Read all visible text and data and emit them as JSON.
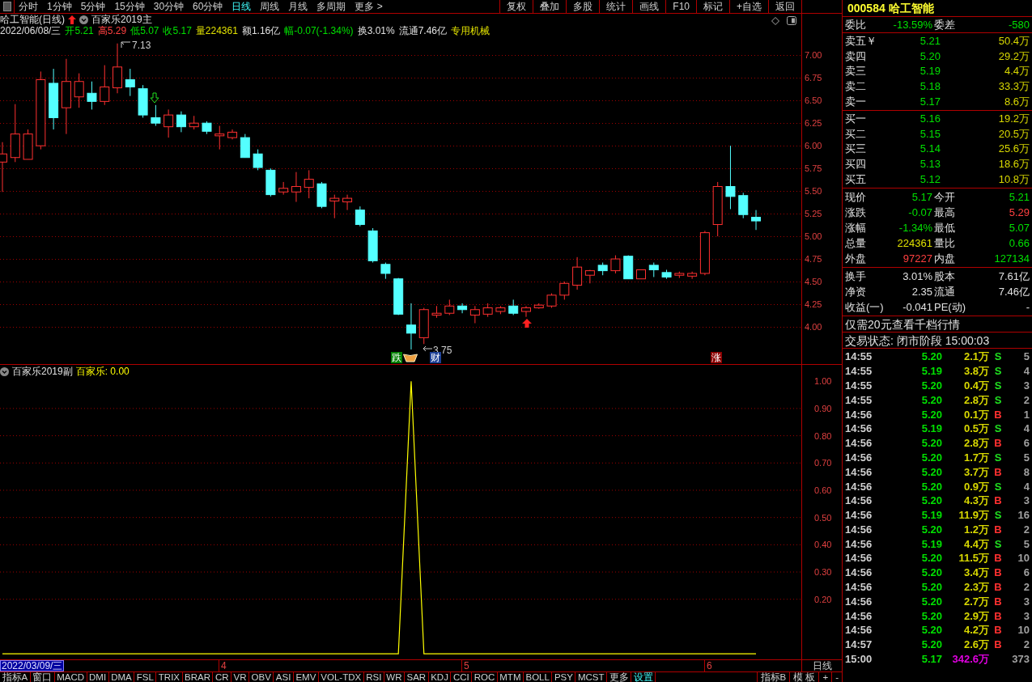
{
  "period_tabs": [
    {
      "label": "分时",
      "selected": false
    },
    {
      "label": "1分钟",
      "selected": false
    },
    {
      "label": "5分钟",
      "selected": false
    },
    {
      "label": "15分钟",
      "selected": false
    },
    {
      "label": "30分钟",
      "selected": false
    },
    {
      "label": "60分钟",
      "selected": false
    },
    {
      "label": "日线",
      "selected": true
    },
    {
      "label": "周线",
      "selected": false
    },
    {
      "label": "月线",
      "selected": false
    },
    {
      "label": "多周期",
      "selected": false
    },
    {
      "label": "更多 >",
      "selected": false
    }
  ],
  "toolbar_buttons": [
    "复权",
    "叠加",
    "多股",
    "统计",
    "画线",
    "F10",
    "标记",
    "+自选",
    "返回"
  ],
  "main_chart": {
    "title": "哈工智能(日线)",
    "indicator": "百家乐2019主",
    "info": [
      {
        "text": "2022/06/08/三",
        "color": "#e0e0e0"
      },
      {
        "text": "开5.21",
        "color": "#00e000"
      },
      {
        "text": "高5.29",
        "color": "#ff4040"
      },
      {
        "text": "低5.07",
        "color": "#00e000"
      },
      {
        "text": "收5.17",
        "color": "#00e000"
      },
      {
        "text": "量224361",
        "color": "#e0e000"
      },
      {
        "text": "额1.16亿",
        "color": "#e0e0e0"
      },
      {
        "text": "幅-0.07(-1.34%)",
        "color": "#00e000"
      },
      {
        "text": "换3.01%",
        "color": "#e0e0e0"
      },
      {
        "text": "流通7.46亿",
        "color": "#e0e0e0"
      },
      {
        "text": "专用机械",
        "color": "#e0e000"
      }
    ],
    "chart_data": {
      "type": "candlestick",
      "grid": true,
      "ylim": [
        3.58,
        7.61
      ],
      "yticks": [
        {
          "value": 7,
          "label": "7.00"
        },
        {
          "value": 6.75,
          "label": "6.75"
        },
        {
          "value": 6.5,
          "label": "6.50"
        },
        {
          "value": 6.25,
          "label": "6.25"
        },
        {
          "value": 6,
          "label": "6.00"
        },
        {
          "value": 5.75,
          "label": "5.75"
        },
        {
          "value": 5.5,
          "label": "5.50"
        },
        {
          "value": 5.25,
          "label": "5.25"
        },
        {
          "value": 5,
          "label": "5.00"
        },
        {
          "value": 4.75,
          "label": "4.75"
        },
        {
          "value": 4.5,
          "label": "4.50"
        },
        {
          "value": 4.25,
          "label": "4.25"
        },
        {
          "value": 4,
          "label": "4.00"
        }
      ],
      "ohlc": [
        [
          5.82,
          6.04,
          5.49,
          5.91
        ],
        [
          5.87,
          6.46,
          5.82,
          6.13
        ],
        [
          5.85,
          6.18,
          5.85,
          6.13
        ],
        [
          6.0,
          6.82,
          5.96,
          6.73
        ],
        [
          6.69,
          6.85,
          6.18,
          6.31
        ],
        [
          6.42,
          6.96,
          6.13,
          6.71
        ],
        [
          6.54,
          6.8,
          6.42,
          6.71
        ],
        [
          6.58,
          6.71,
          6.4,
          6.49
        ],
        [
          6.49,
          6.89,
          6.45,
          6.65
        ],
        [
          6.64,
          7.13,
          6.58,
          6.87
        ],
        [
          6.73,
          6.85,
          6.55,
          6.65
        ],
        [
          6.63,
          6.67,
          6.31,
          6.34
        ],
        [
          6.31,
          6.45,
          6.22,
          6.25
        ],
        [
          6.21,
          6.4,
          6.09,
          6.34
        ],
        [
          6.34,
          6.38,
          6.15,
          6.21
        ],
        [
          6.21,
          6.33,
          6.18,
          6.25
        ],
        [
          6.25,
          6.27,
          6.13,
          6.16
        ],
        [
          6.11,
          6.22,
          5.96,
          6.13
        ],
        [
          6.09,
          6.18,
          6.07,
          6.15
        ],
        [
          6.09,
          6.13,
          5.87,
          5.87
        ],
        [
          5.91,
          5.96,
          5.73,
          5.76
        ],
        [
          5.73,
          5.75,
          5.44,
          5.46
        ],
        [
          5.49,
          5.6,
          5.46,
          5.53
        ],
        [
          5.49,
          5.71,
          5.38,
          5.55
        ],
        [
          5.54,
          5.73,
          5.42,
          5.63
        ],
        [
          5.58,
          5.6,
          5.31,
          5.33
        ],
        [
          5.39,
          5.46,
          5.2,
          5.42
        ],
        [
          5.38,
          5.46,
          5.29,
          5.42
        ],
        [
          5.29,
          5.33,
          5.11,
          5.13
        ],
        [
          5.06,
          5.09,
          4.71,
          4.73
        ],
        [
          4.69,
          4.71,
          4.53,
          4.59
        ],
        [
          4.53,
          4.54,
          4.13,
          4.14
        ],
        [
          4.02,
          4.26,
          3.75,
          3.93
        ],
        [
          3.88,
          4.21,
          3.81,
          4.19
        ],
        [
          4.13,
          4.23,
          4.1,
          4.15
        ],
        [
          4.15,
          4.3,
          4.13,
          4.23
        ],
        [
          4.23,
          4.26,
          4.15,
          4.19
        ],
        [
          4.13,
          4.23,
          4.04,
          4.19
        ],
        [
          4.14,
          4.26,
          4.11,
          4.21
        ],
        [
          4.17,
          4.23,
          4.14,
          4.21
        ],
        [
          4.23,
          4.3,
          4.13,
          4.15
        ],
        [
          4.17,
          4.23,
          4.11,
          4.21
        ],
        [
          4.21,
          4.26,
          4.2,
          4.24
        ],
        [
          4.23,
          4.37,
          4.21,
          4.35
        ],
        [
          4.35,
          4.5,
          4.3,
          4.48
        ],
        [
          4.46,
          4.77,
          4.41,
          4.66
        ],
        [
          4.57,
          4.63,
          4.48,
          4.62
        ],
        [
          4.68,
          4.71,
          4.57,
          4.62
        ],
        [
          4.62,
          4.79,
          4.59,
          4.75
        ],
        [
          4.78,
          4.79,
          4.53,
          4.53
        ],
        [
          4.53,
          4.63,
          4.53,
          4.63
        ],
        [
          4.68,
          4.71,
          4.55,
          4.63
        ],
        [
          4.6,
          4.63,
          4.53,
          4.55
        ],
        [
          4.57,
          4.61,
          4.54,
          4.59
        ],
        [
          4.56,
          4.61,
          4.53,
          4.59
        ],
        [
          4.59,
          5.06,
          4.57,
          5.04
        ],
        [
          5.13,
          5.6,
          5.0,
          5.55
        ],
        [
          5.55,
          6.0,
          5.3,
          5.44
        ],
        [
          5.45,
          5.48,
          5.2,
          5.24
        ],
        [
          5.21,
          5.29,
          5.07,
          5.17
        ]
      ]
    },
    "high_label": "7.13",
    "low_label": "3.75",
    "badges": [
      {
        "text": "跌",
        "color": "#008000"
      },
      {
        "text": "财",
        "color": "#1c3f94"
      },
      {
        "text": "涨",
        "color": "#8b0000"
      }
    ]
  },
  "sub_chart": {
    "title": "百家乐2019副",
    "legend_value": ": 0.00",
    "chart_data": {
      "type": "line",
      "grid": true,
      "ylim": [
        -0.065,
        1.06
      ],
      "yticks": [
        {
          "value": 1,
          "label": "1.00"
        },
        {
          "value": 0.9,
          "label": "0.90"
        },
        {
          "value": 0.8,
          "label": "0.80"
        },
        {
          "value": 0.7,
          "label": "0.70"
        },
        {
          "value": 0.6,
          "label": "0.60"
        },
        {
          "value": 0.5,
          "label": "0.50"
        },
        {
          "value": 0.4,
          "label": "0.40"
        },
        {
          "value": 0.3,
          "label": "0.30"
        },
        {
          "value": 0.2,
          "label": "0.20"
        }
      ],
      "series": [
        {
          "name": "百家乐",
          "color": "#ffff00",
          "values": [
            0,
            0,
            0,
            0,
            0,
            0,
            0,
            0,
            0,
            0,
            0,
            0,
            0,
            0,
            0,
            0,
            0,
            0,
            0,
            0,
            0,
            0,
            0,
            0,
            0,
            0,
            0,
            0,
            0,
            0,
            0,
            0,
            1,
            0,
            0,
            0,
            0,
            0,
            0,
            0,
            0,
            0,
            0,
            0,
            0,
            0,
            0,
            0,
            0,
            0,
            0,
            0,
            0,
            0,
            0,
            0,
            0,
            0,
            0,
            0,
            null,
            null,
            null
          ]
        }
      ]
    }
  },
  "date_axis": {
    "current": "2022/03/09/三",
    "months": [
      "4",
      "5",
      "6"
    ],
    "period": "日线"
  },
  "indicator_tabs": [
    {
      "label": "指标A",
      "highlighted": false
    },
    {
      "label": "窗口",
      "highlighted": false
    },
    {
      "label": "MACD",
      "highlighted": false
    },
    {
      "label": "DMI",
      "highlighted": false
    },
    {
      "label": "DMA",
      "highlighted": false
    },
    {
      "label": "FSL",
      "highlighted": false
    },
    {
      "label": "TRIX",
      "highlighted": false
    },
    {
      "label": "BRAR",
      "highlighted": false
    },
    {
      "label": "CR",
      "highlighted": false
    },
    {
      "label": "VR",
      "highlighted": false
    },
    {
      "label": "OBV",
      "highlighted": false
    },
    {
      "label": "ASI",
      "highlighted": false
    },
    {
      "label": "EMV",
      "highlighted": false
    },
    {
      "label": "VOL-TDX",
      "highlighted": false
    },
    {
      "label": "RSI",
      "highlighted": false
    },
    {
      "label": "WR",
      "highlighted": false
    },
    {
      "label": "SAR",
      "highlighted": false
    },
    {
      "label": "KDJ",
      "highlighted": false
    },
    {
      "label": "CCI",
      "highlighted": false
    },
    {
      "label": "ROC",
      "highlighted": false
    },
    {
      "label": "MTM",
      "highlighted": false
    },
    {
      "label": "BOLL",
      "highlighted": false
    },
    {
      "label": "PSY",
      "highlighted": false
    },
    {
      "label": "MCST",
      "highlighted": false
    },
    {
      "label": "更多",
      "highlighted": false
    },
    {
      "label": "设置",
      "highlighted": true
    }
  ],
  "indicator_tabs_right": [
    "指标B",
    "模 板",
    "+",
    "-"
  ],
  "quote": {
    "title": "000584 哈工智能",
    "ratio": [
      {
        "text": "委比"
      },
      {
        "text": "-13.59%",
        "color": "#00e000"
      },
      {
        "text": "委差"
      },
      {
        "text": "-580",
        "color": "#00e000"
      }
    ],
    "sell": [
      {
        "label": "卖五￥",
        "price": "5.21",
        "volume": "50.4万"
      },
      {
        "label": "卖四",
        "price": "5.20",
        "volume": "29.2万"
      },
      {
        "label": "卖三",
        "price": "5.19",
        "volume": "4.4万"
      },
      {
        "label": "卖二",
        "price": "5.18",
        "volume": "33.3万"
      },
      {
        "label": "卖一",
        "price": "5.17",
        "volume": "8.6万"
      }
    ],
    "buy": [
      {
        "label": "买一",
        "price": "5.16",
        "volume": "19.2万"
      },
      {
        "label": "买二",
        "price": "5.15",
        "volume": "20.5万"
      },
      {
        "label": "买三",
        "price": "5.14",
        "volume": "25.6万"
      },
      {
        "label": "买四",
        "price": "5.13",
        "volume": "18.6万"
      },
      {
        "label": "买五",
        "price": "5.12",
        "volume": "10.8万"
      }
    ],
    "stats": [
      [
        {
          "text": "现价"
        },
        {
          "text": "5.17",
          "color": "#00e000"
        },
        {
          "text": "今开"
        },
        {
          "text": "5.21",
          "color": "#00e000"
        }
      ],
      [
        {
          "text": "涨跌"
        },
        {
          "text": "-0.07",
          "color": "#00e000"
        },
        {
          "text": "最高"
        },
        {
          "text": "5.29",
          "color": "#ff4040"
        }
      ],
      [
        {
          "text": "涨幅"
        },
        {
          "text": "-1.34%",
          "color": "#00e000"
        },
        {
          "text": "最低"
        },
        {
          "text": "5.07",
          "color": "#00e000"
        }
      ],
      [
        {
          "text": "总量"
        },
        {
          "text": "224361",
          "color": "#e0e000"
        },
        {
          "text": "量比"
        },
        {
          "text": "0.66",
          "color": "#00e000"
        }
      ],
      [
        {
          "text": "外盘"
        },
        {
          "text": "97227",
          "color": "#ff4040"
        },
        {
          "text": "内盘"
        },
        {
          "text": "127134",
          "color": "#00e000"
        }
      ]
    ],
    "finance": [
      [
        {
          "text": "换手"
        },
        {
          "text": "3.01%"
        },
        {
          "text": "股本"
        },
        {
          "text": "7.61亿"
        }
      ],
      [
        {
          "text": "净资"
        },
        {
          "text": "2.35"
        },
        {
          "text": "流通"
        },
        {
          "text": "7.46亿"
        }
      ],
      [
        {
          "text": "收益(一)"
        },
        {
          "text": "-0.041"
        },
        {
          "text": "PE(动)"
        },
        {
          "text": "-"
        }
      ]
    ],
    "promo": "仅需20元查看千档行情",
    "status": "交易状态: 闭市阶段 15:00:03",
    "trades": [
      {
        "time": "14:55",
        "price": "5.20",
        "volume": "2.1万",
        "side": "S",
        "kind": "sell",
        "count": "5"
      },
      {
        "time": "14:55",
        "price": "5.19",
        "volume": "3.8万",
        "side": "S",
        "kind": "sell",
        "count": "4"
      },
      {
        "time": "14:55",
        "price": "5.20",
        "volume": "0.4万",
        "side": "S",
        "kind": "sell",
        "count": "3"
      },
      {
        "time": "14:55",
        "price": "5.20",
        "volume": "2.8万",
        "side": "S",
        "kind": "sell",
        "count": "2"
      },
      {
        "time": "14:56",
        "price": "5.20",
        "volume": "0.1万",
        "side": "B",
        "kind": "buy",
        "count": "1"
      },
      {
        "time": "14:56",
        "price": "5.19",
        "volume": "0.5万",
        "side": "S",
        "kind": "sell",
        "count": "4"
      },
      {
        "time": "14:56",
        "price": "5.20",
        "volume": "2.8万",
        "side": "B",
        "kind": "buy",
        "count": "6"
      },
      {
        "time": "14:56",
        "price": "5.20",
        "volume": "1.7万",
        "side": "S",
        "kind": "sell",
        "count": "5"
      },
      {
        "time": "14:56",
        "price": "5.20",
        "volume": "3.7万",
        "side": "B",
        "kind": "buy",
        "count": "8"
      },
      {
        "time": "14:56",
        "price": "5.20",
        "volume": "0.9万",
        "side": "S",
        "kind": "sell",
        "count": "4"
      },
      {
        "time": "14:56",
        "price": "5.20",
        "volume": "4.3万",
        "side": "B",
        "kind": "buy",
        "count": "3"
      },
      {
        "time": "14:56",
        "price": "5.19",
        "volume": "11.9万",
        "side": "S",
        "kind": "sell",
        "count": "16"
      },
      {
        "time": "14:56",
        "price": "5.20",
        "volume": "1.2万",
        "side": "B",
        "kind": "buy",
        "count": "2"
      },
      {
        "time": "14:56",
        "price": "5.19",
        "volume": "4.4万",
        "side": "S",
        "kind": "sell",
        "count": "5"
      },
      {
        "time": "14:56",
        "price": "5.20",
        "volume": "11.5万",
        "side": "B",
        "kind": "buy",
        "count": "10"
      },
      {
        "time": "14:56",
        "price": "5.20",
        "volume": "3.4万",
        "side": "B",
        "kind": "buy",
        "count": "6"
      },
      {
        "time": "14:56",
        "price": "5.20",
        "volume": "2.3万",
        "side": "B",
        "kind": "buy",
        "count": "2"
      },
      {
        "time": "14:56",
        "price": "5.20",
        "volume": "2.7万",
        "side": "B",
        "kind": "buy",
        "count": "3"
      },
      {
        "time": "14:56",
        "price": "5.20",
        "volume": "2.9万",
        "side": "B",
        "kind": "buy",
        "count": "3"
      },
      {
        "time": "14:56",
        "price": "5.20",
        "volume": "4.2万",
        "side": "B",
        "kind": "buy",
        "count": "10"
      },
      {
        "time": "14:57",
        "price": "5.20",
        "volume": "2.6万",
        "side": "B",
        "kind": "buy",
        "count": "2"
      },
      {
        "time": "15:00",
        "price": "5.17",
        "volume": "342.6万",
        "kind": "closing",
        "count": "373"
      }
    ]
  }
}
